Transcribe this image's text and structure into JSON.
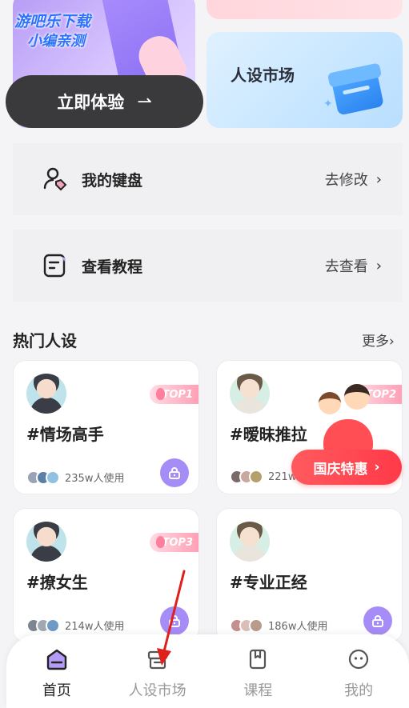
{
  "watermark": {
    "line1": "游吧乐下载",
    "line2": "小编亲测"
  },
  "promo": {
    "try_label": "立即体验",
    "try_arrow": "⇀"
  },
  "market_card": {
    "title": "人设市场"
  },
  "rows": [
    {
      "label": "我的键盘",
      "action": "去修改",
      "icon": "user-tag-icon"
    },
    {
      "label": "查看教程",
      "action": "去查看",
      "icon": "document-icon"
    }
  ],
  "hot": {
    "title": "热门人设",
    "more": "更多",
    "items": [
      {
        "name": "#情场高手",
        "rank": "TOP1",
        "usage": "235w人使用"
      },
      {
        "name": "#暧昧推拉",
        "rank": "TOP2",
        "usage": "221w"
      },
      {
        "name": "#撩女生",
        "rank": "TOP3",
        "usage": "214w人使用"
      },
      {
        "name": "#专业正经",
        "rank": "",
        "usage": "186w人使用"
      }
    ]
  },
  "holiday_badge": {
    "label": "国庆特惠",
    "arrow": "›"
  },
  "nav": [
    {
      "label": "首页",
      "icon": "home-icon",
      "active": true
    },
    {
      "label": "人设市场",
      "icon": "market-icon",
      "active": false
    },
    {
      "label": "课程",
      "icon": "course-icon",
      "active": false
    },
    {
      "label": "我的",
      "icon": "profile-icon",
      "active": false
    }
  ],
  "colors": {
    "accent": "#a58cf6",
    "dark_button": "#3a3a3c",
    "badge_red": "#ff4f55",
    "annotation": "#e0201b"
  }
}
